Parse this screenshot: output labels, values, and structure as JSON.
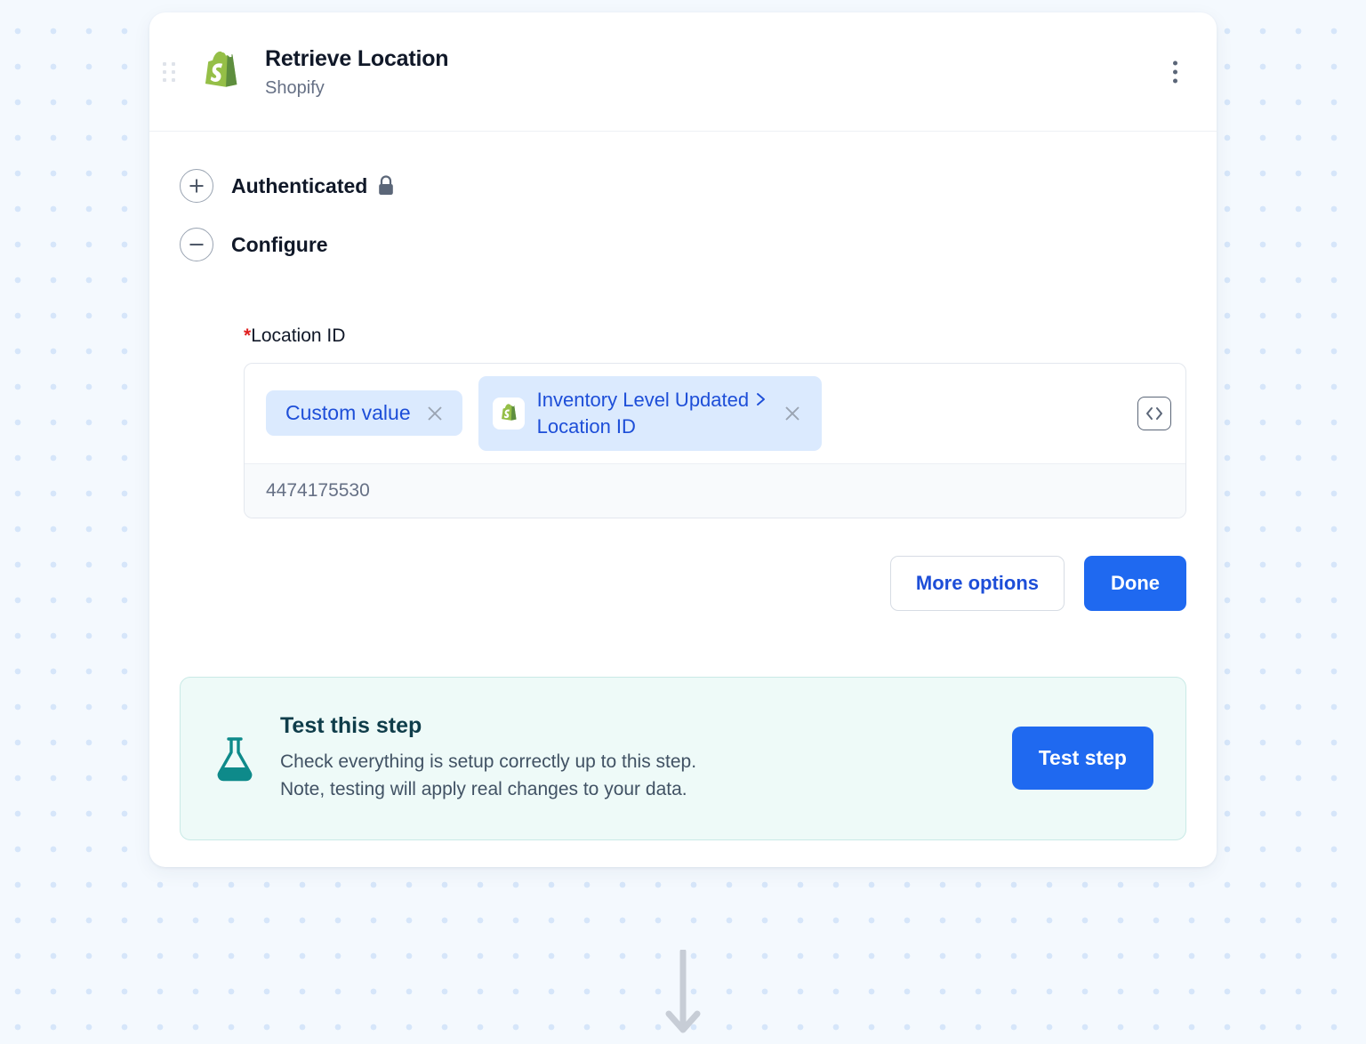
{
  "card": {
    "header": {
      "title": "Retrieve Location",
      "subtitle": "Shopify",
      "app_logo_icon": "shopify-logo",
      "drag_handle_icon": "drag-handle-icon",
      "menu_icon": "kebab-menu-icon"
    },
    "sections": [
      {
        "label": "Authenticated",
        "toggle_icon": "plus-circle-icon",
        "state": "collapsed",
        "badge_icon": "lock-icon"
      },
      {
        "label": "Configure",
        "toggle_icon": "minus-circle-icon",
        "state": "expanded"
      }
    ],
    "field": {
      "required_marker": "*",
      "label": "Location ID",
      "chips": [
        {
          "type": "custom-value",
          "text": "Custom value",
          "close_icon": "close-icon"
        },
        {
          "type": "mapped-field",
          "app_icon": "shopify-icon",
          "line1": "Inventory Level Updated",
          "separator_icon": "chevron-right-icon",
          "line2": "Location ID",
          "close_icon": "close-icon"
        }
      ],
      "code_toggle_icon": "code-brackets-icon",
      "value": "4474175530"
    },
    "actions": {
      "more_options_label": "More options",
      "done_label": "Done"
    },
    "test_panel": {
      "icon": "flask-icon",
      "title": "Test this step",
      "description_line1": "Check everything is setup correctly up to this step.",
      "description_line2": "Note, testing will apply real changes to your data.",
      "button_label": "Test step"
    }
  },
  "flow": {
    "arrow_icon": "arrow-down-icon"
  },
  "colors": {
    "primary_blue": "#1f69f0",
    "chip_blue_bg": "#dbeafe",
    "chip_blue_text": "#1d4ed8",
    "required_red": "#e02020",
    "teal_panel_bg": "#eefaf8",
    "teal_icon": "#0e8a8a",
    "shopify_green": "#95bf47",
    "canvas_bg": "#f4f9fe"
  }
}
